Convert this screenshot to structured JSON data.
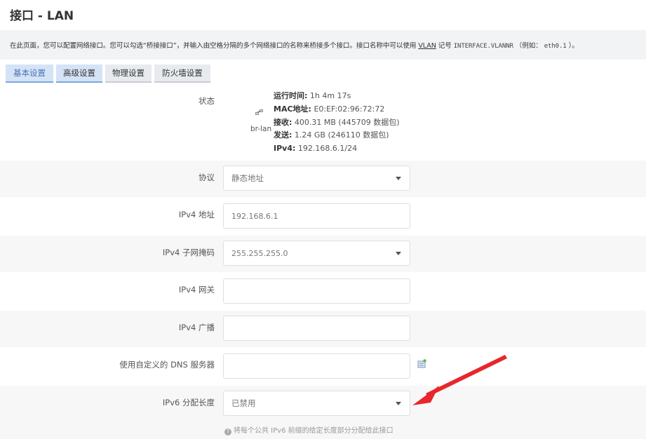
{
  "page": {
    "title": "接口 - LAN",
    "description_prefix": "在此页面，您可以配置网络接口。您可以勾选“桥接接口”，并输入由空格分隔的多个网络接口的名称来桥接多个接口。接口名称中可以使用",
    "description_vlan": "VLAN",
    "description_mid": "记号",
    "description_code": "INTERFACE.VLANNR",
    "description_suffix": "（例如：",
    "description_example": "eth0.1",
    "description_end": "）。"
  },
  "tabs": [
    {
      "label": "基本设置",
      "active": true
    },
    {
      "label": "高级设置",
      "active": false
    },
    {
      "label": "物理设置",
      "active": false
    },
    {
      "label": "防火墙设置",
      "active": false
    }
  ],
  "status": {
    "label": "状态",
    "interface": "br-lan",
    "uptime_key": "运行时间:",
    "uptime_val": "1h 4m 17s",
    "mac_key": "MAC地址:",
    "mac_val": "E0:EF:02:96:72:72",
    "rx_key": "接收:",
    "rx_val": "400.31 MB (445709 数据包)",
    "tx_key": "发送:",
    "tx_val": "1.24 GB (246110 数据包)",
    "ipv4_key": "IPv4:",
    "ipv4_val": "192.168.6.1/24"
  },
  "fields": {
    "protocol": {
      "label": "协议",
      "value": "静态地址"
    },
    "ipv4_addr": {
      "label": "IPv4 地址",
      "value": "192.168.6.1"
    },
    "ipv4_mask": {
      "label": "IPv4 子网掩码",
      "value": "255.255.255.0"
    },
    "ipv4_gw": {
      "label": "IPv4 网关",
      "value": ""
    },
    "ipv4_bcast": {
      "label": "IPv4 广播",
      "value": ""
    },
    "dns": {
      "label": "使用自定义的 DNS 服务器",
      "value": ""
    },
    "ipv6_len": {
      "label": "IPv6 分配长度",
      "value": "已禁用"
    }
  },
  "hint": {
    "icon": "?",
    "text": "将每个公共 IPv6 前缀的给定长度部分分配给此接口"
  },
  "colors": {
    "arrow": "#e8262b",
    "accent": "#4a74b7"
  }
}
